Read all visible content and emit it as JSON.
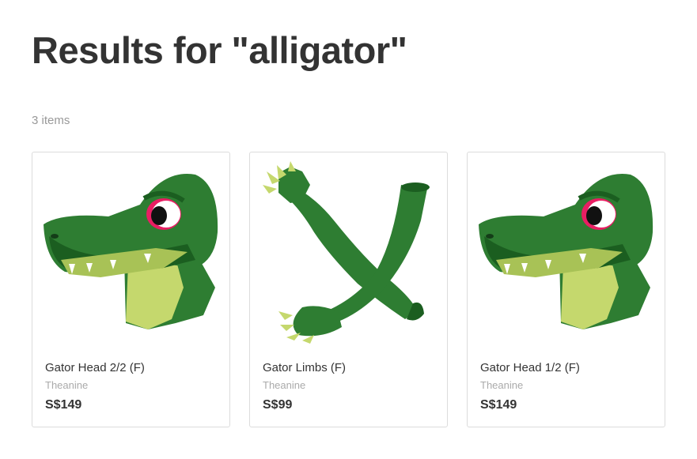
{
  "header": {
    "title": "Results for \"alligator\""
  },
  "results": {
    "count_label": "3 items",
    "items": [
      {
        "name": "Gator Head 2/2 (F)",
        "creator": "Theanine",
        "price": "S$149",
        "thumbnail": "gator-head"
      },
      {
        "name": "Gator Limbs (F)",
        "creator": "Theanine",
        "price": "S$99",
        "thumbnail": "gator-limbs"
      },
      {
        "name": "Gator Head 1/2 (F)",
        "creator": "Theanine",
        "price": "S$149",
        "thumbnail": "gator-head"
      }
    ]
  },
  "colors": {
    "gator_green": "#2e7d32",
    "gator_dark": "#1b5e20",
    "belly": "#c5d86d",
    "eye_ring": "#e91e63"
  }
}
